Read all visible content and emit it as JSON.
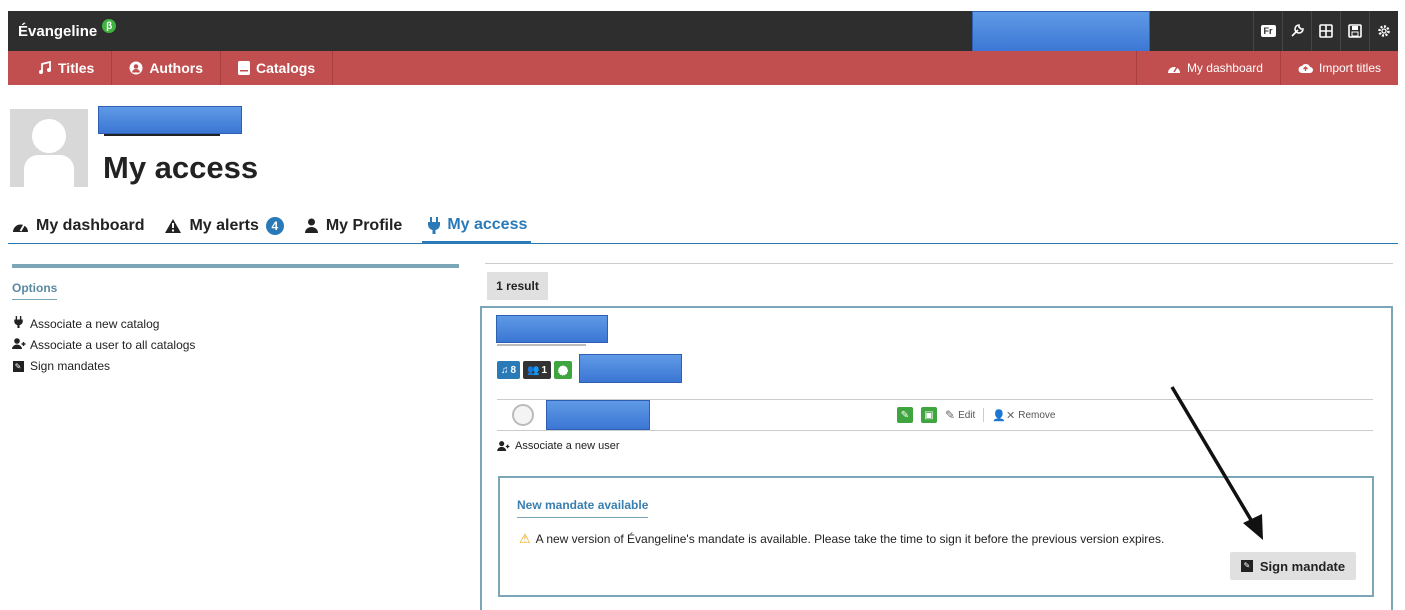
{
  "topbar": {
    "brand": "Évangeline",
    "beta": "β",
    "lang_button": "Fr",
    "icons": [
      "wrench-icon",
      "layout-icon",
      "save-icon",
      "gear-icon"
    ]
  },
  "nav": {
    "items": [
      {
        "label": "Titles",
        "icon": "music-note-icon"
      },
      {
        "label": "Authors",
        "icon": "user-circle-icon"
      },
      {
        "label": "Catalogs",
        "icon": "book-icon"
      }
    ],
    "right_items": [
      {
        "label": "My dashboard",
        "icon": "dashboard-icon"
      },
      {
        "label": "Import titles",
        "icon": "cloud-upload-icon"
      }
    ]
  },
  "page": {
    "title": "My access"
  },
  "tabs": [
    {
      "label": "My dashboard",
      "icon": "dashboard-icon"
    },
    {
      "label": "My alerts",
      "icon": "warning-icon",
      "badge": "4"
    },
    {
      "label": "My Profile",
      "icon": "user-icon"
    },
    {
      "label": "My access",
      "icon": "plug-icon",
      "active": true
    }
  ],
  "sidebar": {
    "title": "Options",
    "items": [
      {
        "label": "Associate a new catalog",
        "icon": "plug-icon"
      },
      {
        "label": "Associate a user to all catalogs",
        "icon": "user-plus-icon"
      },
      {
        "label": "Sign mandates",
        "icon": "edit-icon"
      }
    ]
  },
  "results": {
    "count_label": "1 result",
    "chips": {
      "titles": "8",
      "users": "1"
    },
    "user_row": {
      "edit_label": "Edit",
      "remove_label": "Remove"
    },
    "associate_label": "Associate a new user",
    "mandate": {
      "title": "New mandate available",
      "text": "A new version of Évangeline's mandate is available. Please take the time to sign it before the previous version expires.",
      "button_label": "Sign mandate"
    }
  },
  "colors": {
    "topbar": "#2e2e2e",
    "nav": "#c24f4f",
    "accent": "#2a7ab8",
    "green": "#3fa63f",
    "border": "#7aa6b8"
  }
}
